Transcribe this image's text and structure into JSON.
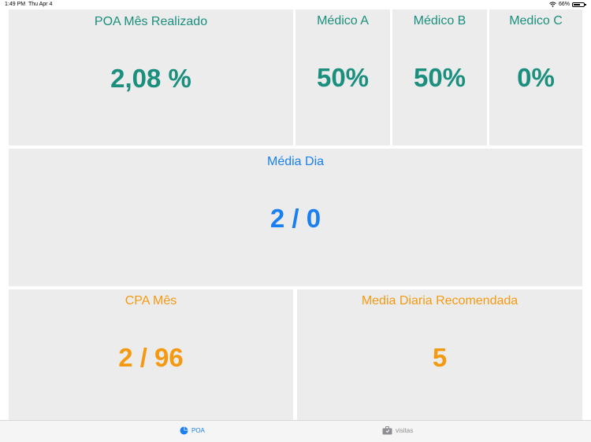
{
  "status_bar": {
    "time": "1:49 PM",
    "date": "Thu Apr 4",
    "battery": "66%",
    "battery_level": 0.66,
    "wifi_icon": "wifi-icon"
  },
  "tiles": {
    "poa": {
      "label": "POA Mês Realizado",
      "value": "2,08 %"
    },
    "medico_a": {
      "label": "Médico A",
      "value": "50%"
    },
    "medico_b": {
      "label": "Médico B",
      "value": "50%"
    },
    "medico_c": {
      "label": "Medico C",
      "value": "0%"
    },
    "media_dia": {
      "label": "Média Dia",
      "value": "2 / 0"
    },
    "cpa": {
      "label": "CPA Mês",
      "value": "2 / 96"
    },
    "media_recomendada": {
      "label": "Media Diaria Recomendada",
      "value": "5"
    }
  },
  "colors": {
    "teal": "#1a8f7e",
    "blue": "#1a7ff0",
    "orange": "#f49a12",
    "tile_bg": "#ececec"
  },
  "tab_bar": {
    "tabs": [
      {
        "label": "POA",
        "icon": "pie-chart-icon",
        "active": true
      },
      {
        "label": "visitas",
        "icon": "briefcase-icon",
        "active": false
      }
    ]
  }
}
